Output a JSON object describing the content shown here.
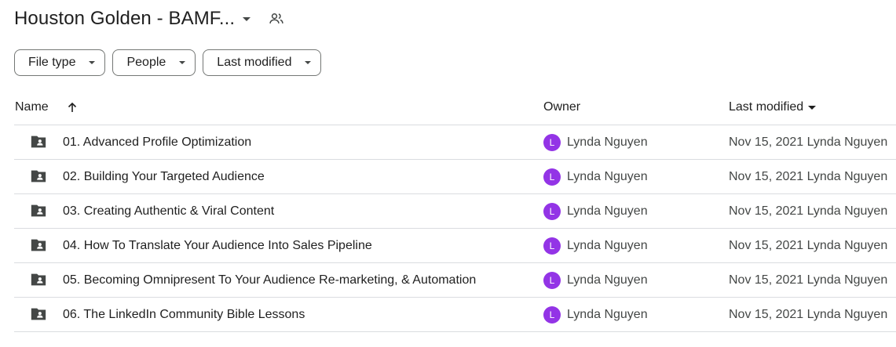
{
  "header": {
    "title": "Houston Golden - BAMF...",
    "title_dropdown_icon": "caret-down-icon",
    "shared_icon": "people-icon"
  },
  "filters": [
    {
      "label": "File type"
    },
    {
      "label": "People"
    },
    {
      "label": "Last modified"
    }
  ],
  "table": {
    "columns": {
      "name": "Name",
      "owner": "Owner",
      "modified": "Last modified"
    },
    "sort_icon": "arrow-up-icon",
    "rows": [
      {
        "name": "01. Advanced Profile Optimization",
        "owner_initial": "L",
        "owner": "Lynda Nguyen",
        "modified": "Nov 15, 2021 Lynda Nguyen"
      },
      {
        "name": "02. Building Your Targeted Audience",
        "owner_initial": "L",
        "owner": "Lynda Nguyen",
        "modified": "Nov 15, 2021 Lynda Nguyen"
      },
      {
        "name": "03. Creating Authentic & Viral Content",
        "owner_initial": "L",
        "owner": "Lynda Nguyen",
        "modified": "Nov 15, 2021 Lynda Nguyen"
      },
      {
        "name": "04. How To Translate Your Audience Into Sales Pipeline",
        "owner_initial": "L",
        "owner": "Lynda Nguyen",
        "modified": "Nov 15, 2021 Lynda Nguyen"
      },
      {
        "name": "05. Becoming Omnipresent To Your Audience Re-marketing, & Automation",
        "owner_initial": "L",
        "owner": "Lynda Nguyen",
        "modified": "Nov 15, 2021 Lynda Nguyen"
      },
      {
        "name": "06. The LinkedIn Community Bible Lessons",
        "owner_initial": "L",
        "owner": "Lynda Nguyen",
        "modified": "Nov 15, 2021 Lynda Nguyen"
      }
    ]
  },
  "colors": {
    "avatar": "#9334e6",
    "folder_icon": "#444746",
    "divider": "#dadce0"
  }
}
